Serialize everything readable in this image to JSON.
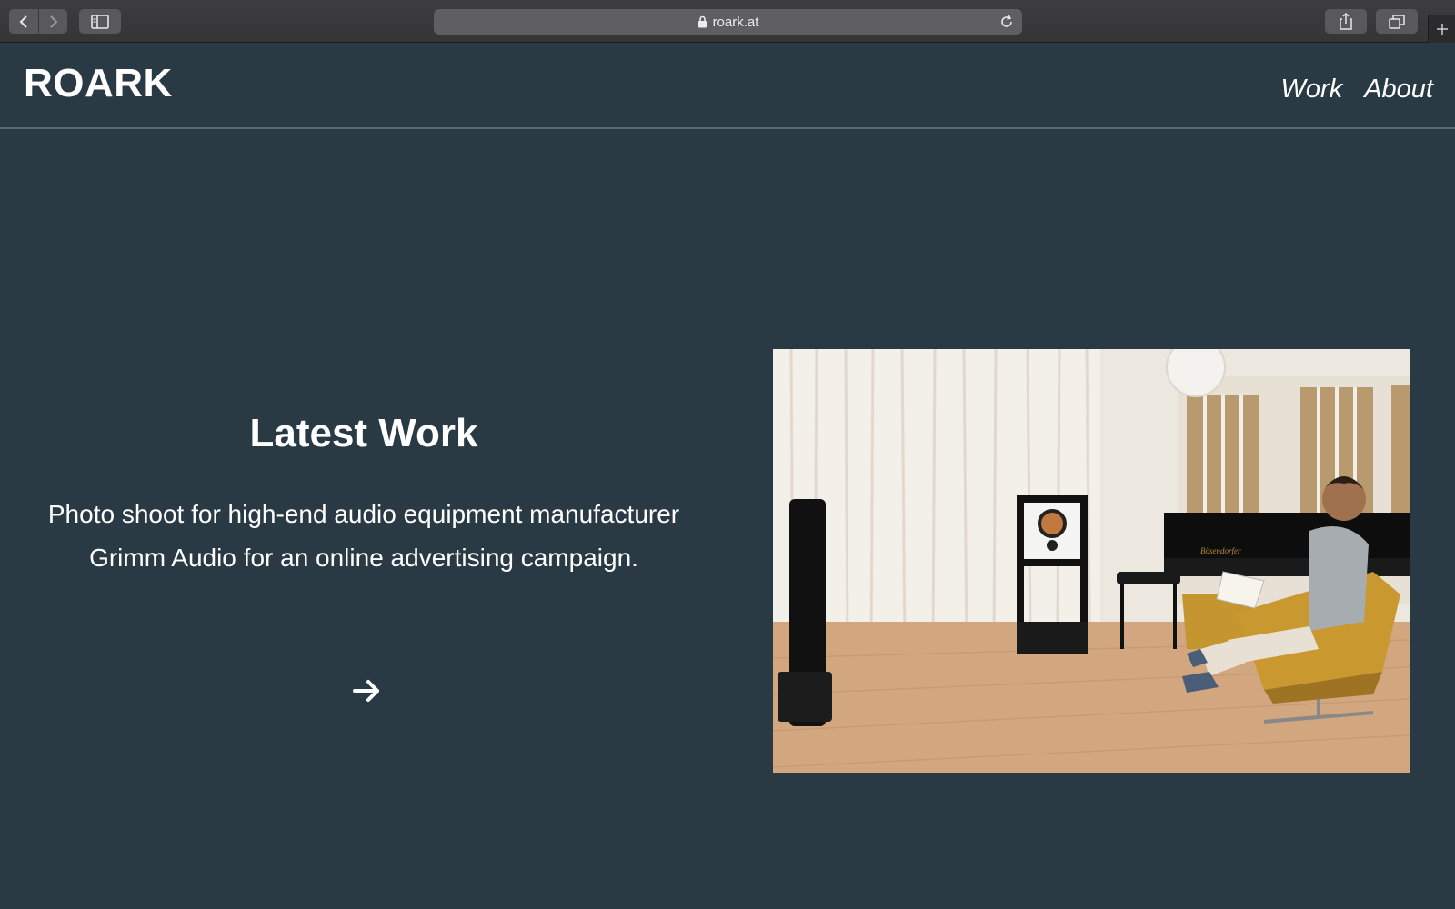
{
  "browser": {
    "url": "roark.at"
  },
  "site": {
    "logo": "ROARK",
    "nav": [
      {
        "label": "Work"
      },
      {
        "label": "About"
      }
    ]
  },
  "hero": {
    "title": "Latest Work",
    "description": "Photo shoot for high-end audio equipment manufacturer Grimm Audio for an online advertising campaign.",
    "arrow_icon": "arrow-right-icon",
    "photo_text": "Bösendorfer"
  },
  "colors": {
    "background": "#2a3a45",
    "header_border": "#4c6e72",
    "text": "#ffffff"
  }
}
